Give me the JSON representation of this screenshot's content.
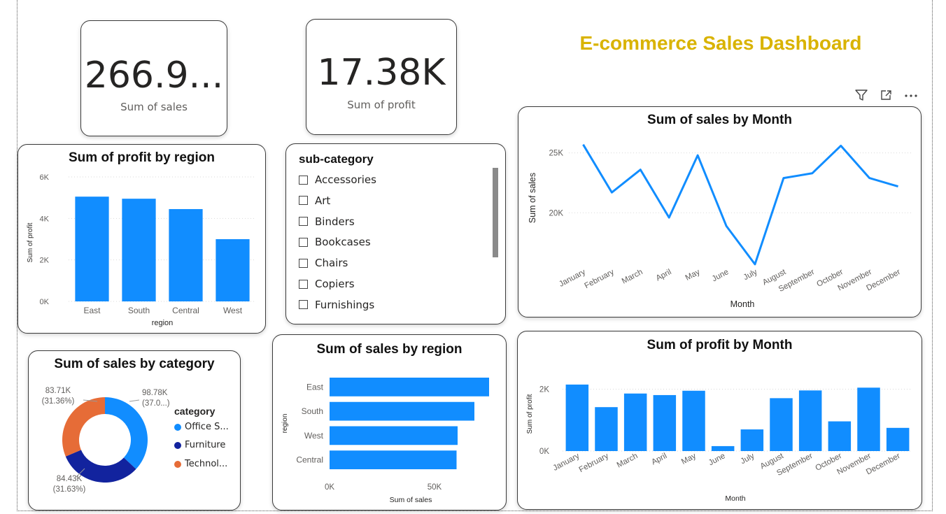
{
  "dashboard": {
    "title": "E-commerce Sales Dashboard"
  },
  "colors": {
    "primary": "#118DFF",
    "dark_blue": "#12239E",
    "orange": "#E66C37",
    "title_gold": "#d9b300"
  },
  "kpis": [
    {
      "value": "266.9...",
      "label": "Sum of sales"
    },
    {
      "value": "17.38K",
      "label": "Sum of profit"
    }
  ],
  "header_icons": [
    "filter-icon",
    "focus-mode-icon",
    "more-options-icon"
  ],
  "slicer": {
    "title": "sub-category",
    "items": [
      "Accessories",
      "Art",
      "Binders",
      "Bookcases",
      "Chairs",
      "Copiers",
      "Furnishings"
    ]
  },
  "chart_data": [
    {
      "id": "profit-by-region",
      "type": "bar",
      "title": "Sum of profit by region",
      "xlabel": "region",
      "ylabel": "Sum of profit",
      "categories": [
        "East",
        "South",
        "Central",
        "West"
      ],
      "values": [
        5050,
        4950,
        4450,
        3000
      ],
      "ylim": [
        0,
        6000
      ],
      "yticks": [
        "0K",
        "2K",
        "4K",
        "6K"
      ],
      "ytick_values": [
        0,
        2000,
        4000,
        6000
      ],
      "grid": true
    },
    {
      "id": "sales-by-category",
      "type": "pie",
      "title": "Sum of sales by category",
      "legend_title": "category",
      "legend_position": "right",
      "categories": [
        "Office S...",
        "Furniture",
        "Technol..."
      ],
      "values": [
        98780,
        84430,
        83710
      ],
      "data_labels": [
        "98.78K\n(37.0...)",
        "84.43K\n(31.63%)",
        "83.71K\n(31.36%)"
      ]
    },
    {
      "id": "sales-by-region",
      "type": "bar",
      "orientation": "horizontal",
      "title": "Sum of sales by region",
      "xlabel": "Sum of sales",
      "ylabel": "region",
      "categories": [
        "East",
        "South",
        "West",
        "Central"
      ],
      "values": [
        76000,
        69000,
        61000,
        60500
      ],
      "xlim": [
        0,
        80000
      ],
      "xticks": [
        "0K",
        "50K"
      ],
      "xtick_values": [
        0,
        50000
      ]
    },
    {
      "id": "sales-by-month",
      "type": "line",
      "title": "Sum of sales by Month",
      "xlabel": "Month",
      "ylabel": "Sum of sales",
      "categories": [
        "January",
        "February",
        "March",
        "April",
        "May",
        "June",
        "July",
        "August",
        "September",
        "October",
        "November",
        "December"
      ],
      "values": [
        25700,
        21700,
        23600,
        19600,
        24800,
        18900,
        15700,
        22900,
        23300,
        25600,
        22900,
        22200
      ],
      "ylim": [
        15400,
        26500
      ],
      "yticks": [
        "20K",
        "25K"
      ],
      "ytick_values": [
        20000,
        25000
      ],
      "grid": true
    },
    {
      "id": "profit-by-month",
      "type": "bar",
      "title": "Sum of profit by Month",
      "xlabel": "Month",
      "ylabel": "Sum of profit",
      "categories": [
        "January",
        "February",
        "March",
        "April",
        "May",
        "June",
        "July",
        "August",
        "September",
        "October",
        "November",
        "December"
      ],
      "values": [
        2150,
        1420,
        1860,
        1810,
        1950,
        160,
        700,
        1710,
        1960,
        960,
        2050,
        750
      ],
      "ylim": [
        0,
        2600
      ],
      "yticks": [
        "0K",
        "2K"
      ],
      "ytick_values": [
        0,
        2000
      ],
      "grid": true
    }
  ]
}
